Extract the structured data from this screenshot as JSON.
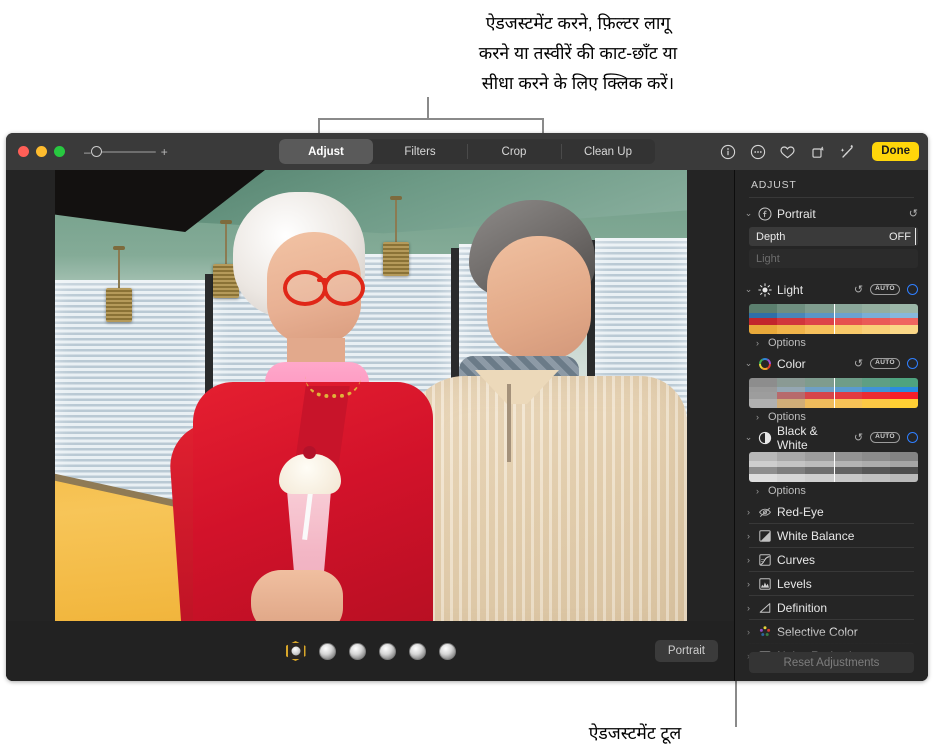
{
  "callouts": {
    "top": "ऐडजस्टमेंट करने, फ़िल्टर लागू\nकरने या तस्वीरें की काट-छाँट या\nसीधा करने के लिए क्लिक करें।",
    "bottom": "ऐडजस्टमेंट टूल"
  },
  "window": {
    "traffic_lights": [
      "close",
      "minimize",
      "zoom"
    ],
    "zoom_slider": {
      "minus": "–",
      "plus": "+",
      "value": 0
    },
    "tabs": [
      {
        "label": "Adjust",
        "active": true
      },
      {
        "label": "Filters",
        "active": false
      },
      {
        "label": "Crop",
        "active": false
      },
      {
        "label": "Clean Up",
        "active": false
      }
    ],
    "right_tools": [
      {
        "name": "info-icon",
        "glyph": "i"
      },
      {
        "name": "more-options-icon",
        "glyph": "..."
      },
      {
        "name": "favorite-heart-icon",
        "glyph": "heart"
      },
      {
        "name": "rotate-icon",
        "glyph": "rotate"
      },
      {
        "name": "auto-enhance-icon",
        "glyph": "wand"
      }
    ],
    "done_label": "Done"
  },
  "bottom_bar": {
    "portrait_badge": "Portrait",
    "thumbnail_count": 6,
    "selected_index": 0
  },
  "sidebar": {
    "title": "ADJUST",
    "portrait": {
      "label": "Portrait",
      "icon": "f-stop-icon",
      "revert": "↺",
      "depth_label": "Depth",
      "depth_value": "OFF",
      "light_label": "Light"
    },
    "sections": [
      {
        "label": "Light",
        "icon": "sun-icon",
        "expanded": true,
        "revert": "↺",
        "auto": "AUTO",
        "toggle": "on",
        "options_label": "Options"
      },
      {
        "label": "Color",
        "icon": "color-wheel-icon",
        "expanded": true,
        "revert": "↺",
        "auto": "AUTO",
        "toggle": "on",
        "options_label": "Options"
      },
      {
        "label": "Black & White",
        "icon": "half-circle-icon",
        "expanded": true,
        "revert": "↺",
        "auto": "AUTO",
        "toggle": "on",
        "options_label": "Options"
      }
    ],
    "collapsed_items": [
      {
        "label": "Red-Eye",
        "icon": "eye-slash-icon"
      },
      {
        "label": "White Balance",
        "icon": "white-balance-icon"
      },
      {
        "label": "Curves",
        "icon": "curves-icon"
      },
      {
        "label": "Levels",
        "icon": "levels-icon"
      },
      {
        "label": "Definition",
        "icon": "definition-icon"
      },
      {
        "label": "Selective Color",
        "icon": "selective-color-icon"
      },
      {
        "label": "Noise Reduction",
        "icon": "noise-reduction-icon"
      }
    ],
    "reset_label": "Reset Adjustments"
  },
  "colors": {
    "accent_yellow": "#ffd60a",
    "toggle_blue": "#2f7fff",
    "window_chrome": "#3a3a3a",
    "sidebar_bg": "#252525",
    "canvas_bg": "#242424"
  }
}
